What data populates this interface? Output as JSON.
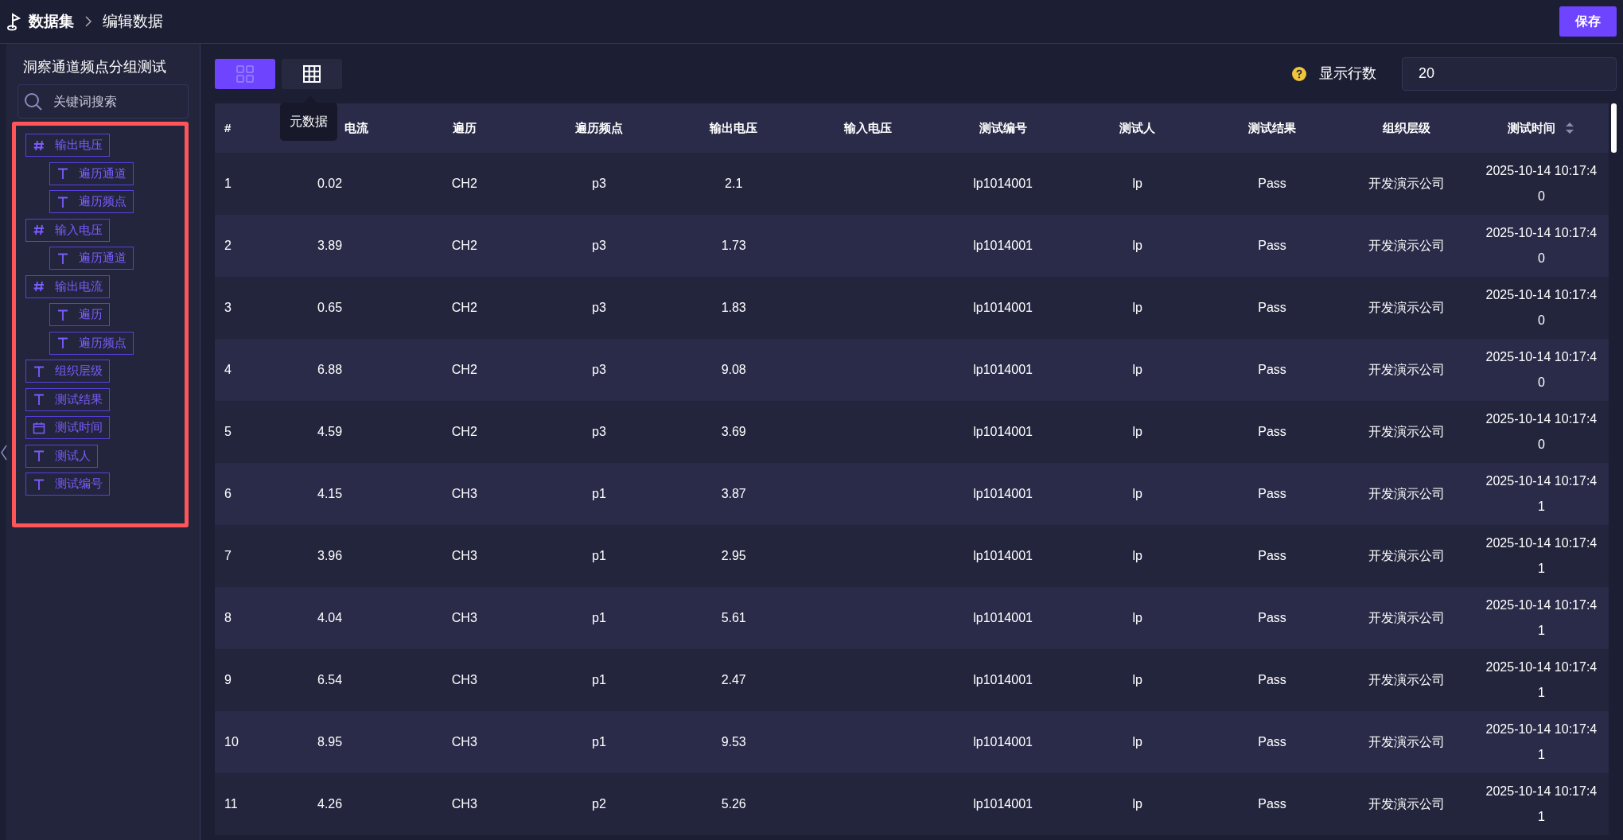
{
  "breadcrumb": [
    "数据集",
    "编辑数据"
  ],
  "save_button": "保存",
  "sidebar": {
    "title": "洞察通道频点分组测试",
    "search": {
      "placeholder": "关键词搜索"
    },
    "fields": [
      {
        "label": "输出电压",
        "kind": "number",
        "children": [
          {
            "label": "遍历通道",
            "kind": "text"
          },
          {
            "label": "遍历频点",
            "kind": "text"
          }
        ]
      },
      {
        "label": "输入电压",
        "kind": "number",
        "children": [
          {
            "label": "遍历通道",
            "kind": "text"
          }
        ]
      },
      {
        "label": "输出电流",
        "kind": "number",
        "children": [
          {
            "label": "遍历",
            "kind": "text"
          },
          {
            "label": "遍历频点",
            "kind": "text"
          }
        ]
      },
      {
        "label": "组织层级",
        "kind": "text"
      },
      {
        "label": "测试结果",
        "kind": "text"
      },
      {
        "label": "测试时间",
        "kind": "date"
      },
      {
        "label": "测试人",
        "kind": "text"
      },
      {
        "label": "测试编号",
        "kind": "text"
      }
    ]
  },
  "toolbar": {
    "view_buttons": [
      {
        "kind": "cards",
        "selected": true
      },
      {
        "kind": "table",
        "selected": false
      }
    ],
    "tooltip": "元数据",
    "rows_label": "显示行数",
    "rows_value": "20"
  },
  "table": {
    "columns": [
      "#",
      "电流",
      "遍历",
      "遍历频点",
      "输出电压",
      "输入电压",
      "测试编号",
      "测试人",
      "测试结果",
      "组织层级",
      "测试时间"
    ],
    "rows": [
      [
        "1",
        "0.02",
        "CH2",
        "p3",
        "2.1",
        "",
        "lp1014001",
        "lp",
        "Pass",
        "开发演示公司",
        "2025-10-14 10:17:40"
      ],
      [
        "2",
        "3.89",
        "CH2",
        "p3",
        "1.73",
        "",
        "lp1014001",
        "lp",
        "Pass",
        "开发演示公司",
        "2025-10-14 10:17:40"
      ],
      [
        "3",
        "0.65",
        "CH2",
        "p3",
        "1.83",
        "",
        "lp1014001",
        "lp",
        "Pass",
        "开发演示公司",
        "2025-10-14 10:17:40"
      ],
      [
        "4",
        "6.88",
        "CH2",
        "p3",
        "9.08",
        "",
        "lp1014001",
        "lp",
        "Pass",
        "开发演示公司",
        "2025-10-14 10:17:40"
      ],
      [
        "5",
        "4.59",
        "CH2",
        "p3",
        "3.69",
        "",
        "lp1014001",
        "lp",
        "Pass",
        "开发演示公司",
        "2025-10-14 10:17:40"
      ],
      [
        "6",
        "4.15",
        "CH3",
        "p1",
        "3.87",
        "",
        "lp1014001",
        "lp",
        "Pass",
        "开发演示公司",
        "2025-10-14 10:17:41"
      ],
      [
        "7",
        "3.96",
        "CH3",
        "p1",
        "2.95",
        "",
        "lp1014001",
        "lp",
        "Pass",
        "开发演示公司",
        "2025-10-14 10:17:41"
      ],
      [
        "8",
        "4.04",
        "CH3",
        "p1",
        "5.61",
        "",
        "lp1014001",
        "lp",
        "Pass",
        "开发演示公司",
        "2025-10-14 10:17:41"
      ],
      [
        "9",
        "6.54",
        "CH3",
        "p1",
        "2.47",
        "",
        "lp1014001",
        "lp",
        "Pass",
        "开发演示公司",
        "2025-10-14 10:17:41"
      ],
      [
        "10",
        "8.95",
        "CH3",
        "p1",
        "9.53",
        "",
        "lp1014001",
        "lp",
        "Pass",
        "开发演示公司",
        "2025-10-14 10:17:41"
      ],
      [
        "11",
        "4.26",
        "CH3",
        "p2",
        "5.26",
        "",
        "lp1014001",
        "lp",
        "Pass",
        "开发演示公司",
        "2025-10-14 10:17:41"
      ]
    ]
  }
}
